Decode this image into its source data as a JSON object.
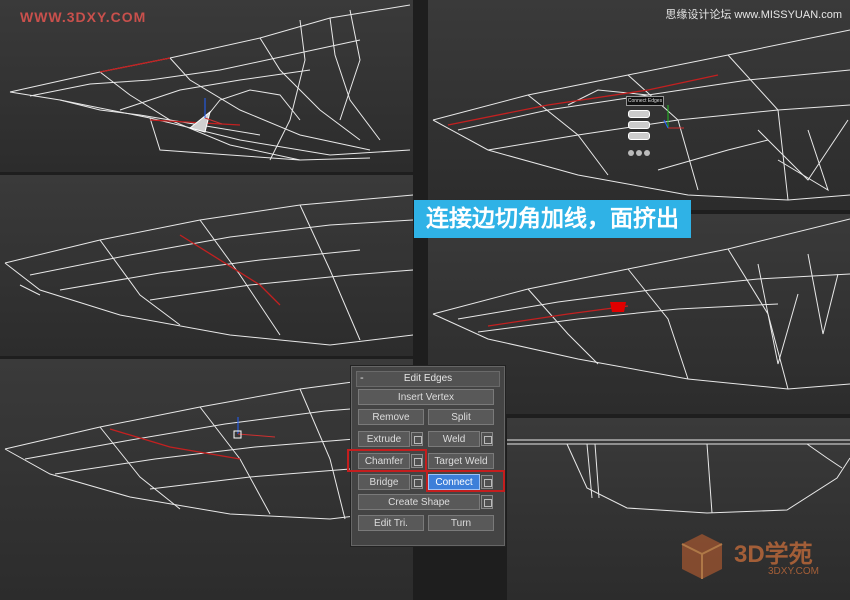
{
  "watermark_left": "WWW.3DXY.COM",
  "watermark_right": "思缘设计论坛 www.MISSYUAN.com",
  "banner_text": "连接边切角加线，面挤出",
  "edit_edges": {
    "minus": "-",
    "title": "Edit Edges",
    "insert_vertex": "Insert Vertex",
    "remove": "Remove",
    "split": "Split",
    "extrude": "Extrude",
    "weld": "Weld",
    "chamfer": "Chamfer",
    "target_weld": "Target Weld",
    "bridge": "Bridge",
    "connect": "Connect",
    "create_shape": "Create Shape",
    "edit_tri": "Edit Tri.",
    "turn": "Turn"
  },
  "caddy_title": "Connect Edges",
  "logo": {
    "name": "3D学苑",
    "url": "3DXY.COM"
  },
  "colors": {
    "highlight": "#c41e1e",
    "banner": "#2fb2e6",
    "active": "#3d7fd9",
    "selected_edge": "#d02020"
  }
}
